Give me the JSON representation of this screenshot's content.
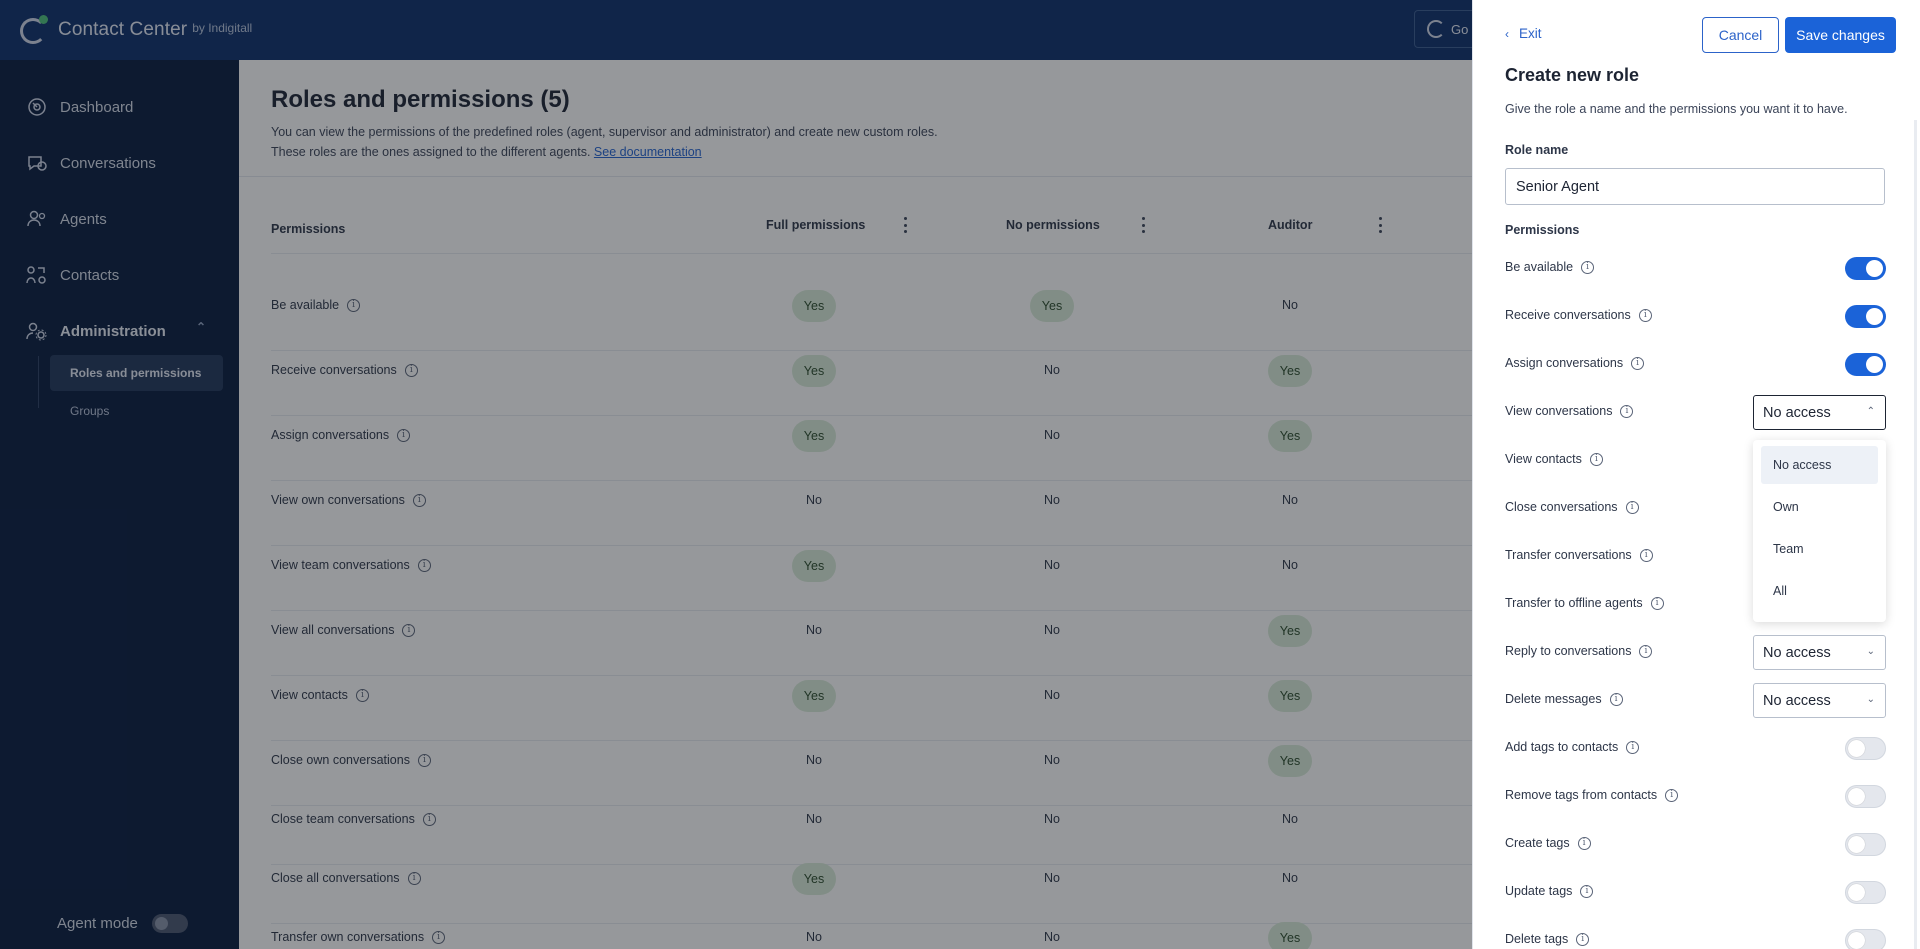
{
  "app": {
    "name": "Contact Center",
    "by": "by Indigitall",
    "top_chip_text": "Go"
  },
  "sidebar": {
    "items": [
      {
        "label": "Dashboard",
        "icon": "dashboard-icon"
      },
      {
        "label": "Conversations",
        "icon": "conversations-icon"
      },
      {
        "label": "Agents",
        "icon": "agents-icon"
      },
      {
        "label": "Contacts",
        "icon": "contacts-icon"
      },
      {
        "label": "Administration",
        "icon": "administration-icon"
      }
    ],
    "sub_items": [
      {
        "label": "Roles and permissions",
        "active": true
      },
      {
        "label": "Groups",
        "active": false
      }
    ],
    "agent_mode_label": "Agent mode",
    "agent_mode_on": false
  },
  "main": {
    "title": "Roles and permissions (5)",
    "desc_line1": "You can view the permissions of the predefined roles (agent, supervisor and administrator) and create new custom roles.",
    "desc_line2": "These roles are the ones assigned to the different agents.",
    "doc_link": "See documentation",
    "columns": [
      "Permissions",
      "Full permissions",
      "No permissions",
      "Auditor"
    ],
    "rows": [
      {
        "label": "Be available",
        "values": [
          "Yes",
          "Yes",
          "No"
        ]
      },
      {
        "label": "Receive conversations",
        "values": [
          "Yes",
          "No",
          "Yes"
        ]
      },
      {
        "label": "Assign conversations",
        "values": [
          "Yes",
          "No",
          "Yes"
        ]
      },
      {
        "label": "View own conversations",
        "values": [
          "No",
          "No",
          "No"
        ]
      },
      {
        "label": "View team conversations",
        "values": [
          "Yes",
          "No",
          "No"
        ]
      },
      {
        "label": "View all conversations",
        "values": [
          "No",
          "No",
          "Yes"
        ]
      },
      {
        "label": "View contacts",
        "values": [
          "Yes",
          "No",
          "Yes"
        ]
      },
      {
        "label": "Close own conversations",
        "values": [
          "No",
          "No",
          "Yes"
        ]
      },
      {
        "label": "Close team conversations",
        "values": [
          "No",
          "No",
          "No"
        ]
      },
      {
        "label": "Close all conversations",
        "values": [
          "Yes",
          "No",
          "No"
        ]
      },
      {
        "label": "Transfer own conversations",
        "values": [
          "No",
          "No",
          "Yes"
        ]
      }
    ]
  },
  "panel": {
    "exit_label": "Exit",
    "cancel_label": "Cancel",
    "save_label": "Save changes",
    "title": "Create new role",
    "subtitle": "Give the role a name and the permissions you want it to have.",
    "role_name_label": "Role name",
    "role_name_value": "Senior Agent",
    "permissions_label": "Permissions",
    "permissions": [
      {
        "label": "Be available",
        "control": "toggle",
        "on": true
      },
      {
        "label": "Receive conversations",
        "control": "toggle",
        "on": true
      },
      {
        "label": "Assign conversations",
        "control": "toggle",
        "on": true
      },
      {
        "label": "View conversations",
        "control": "select",
        "value": "No access",
        "open": true
      },
      {
        "label": "View contacts",
        "control": "select-hidden"
      },
      {
        "label": "Close conversations",
        "control": "select-hidden"
      },
      {
        "label": "Transfer conversations",
        "control": "select-hidden"
      },
      {
        "label": "Transfer to offline agents",
        "control": "select-hidden"
      },
      {
        "label": "Reply to conversations",
        "control": "select",
        "value": "No access",
        "open": false
      },
      {
        "label": "Delete messages",
        "control": "select",
        "value": "No access",
        "open": false
      },
      {
        "label": "Add tags to contacts",
        "control": "toggle",
        "on": false
      },
      {
        "label": "Remove tags from contacts",
        "control": "toggle",
        "on": false
      },
      {
        "label": "Create tags",
        "control": "toggle",
        "on": false
      },
      {
        "label": "Update tags",
        "control": "toggle",
        "on": false
      },
      {
        "label": "Delete tags",
        "control": "toggle",
        "on": false
      }
    ],
    "dropdown_options": [
      "No access",
      "Own",
      "Team",
      "All"
    ],
    "dropdown_selected": "No access"
  },
  "colors": {
    "topbar": "#0b2e6b",
    "sidebar": "#061a3d",
    "primary": "#1b63d8",
    "yes_pill": "#d9ecd9",
    "logo_dot": "#4ec27a"
  }
}
